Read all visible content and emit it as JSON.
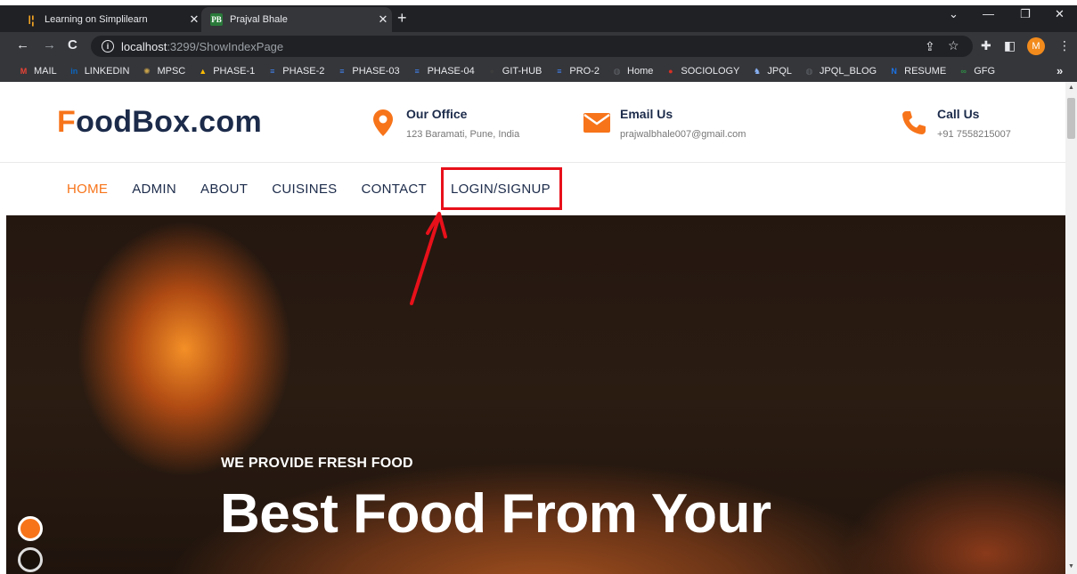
{
  "browser": {
    "tabs": [
      {
        "title": "Learning on Simplilearn",
        "favicon": "simplilearn-icon",
        "active": false
      },
      {
        "title": "Prajval Bhale",
        "favicon": "PB",
        "active": true
      }
    ],
    "url_host": "localhost",
    "url_path": ":3299/ShowIndexPage",
    "profile_initial": "M",
    "bookmarks": [
      {
        "label": "MAIL",
        "icon": "gmail-icon",
        "color": "#ea4335",
        "glyph": "M"
      },
      {
        "label": "LINKEDIN",
        "icon": "linkedin-icon",
        "color": "#0a66c2",
        "glyph": "in"
      },
      {
        "label": "MPSC",
        "icon": "emblem-icon",
        "color": "#c8a24a",
        "glyph": "✺"
      },
      {
        "label": "PHASE-1",
        "icon": "drive-icon",
        "color": "#fbbc04",
        "glyph": "▲"
      },
      {
        "label": "PHASE-2",
        "icon": "docs-icon",
        "color": "#4285f4",
        "glyph": "≡"
      },
      {
        "label": "PHASE-03",
        "icon": "docs-icon",
        "color": "#4285f4",
        "glyph": "≡"
      },
      {
        "label": "PHASE-04",
        "icon": "docs-icon",
        "color": "#4285f4",
        "glyph": "≡"
      },
      {
        "label": "GIT-HUB",
        "icon": "github-icon",
        "color": "#3c3c3c",
        "glyph": "●"
      },
      {
        "label": "PRO-2",
        "icon": "docs-icon",
        "color": "#4285f4",
        "glyph": "≡"
      },
      {
        "label": "Home",
        "icon": "globe-icon",
        "color": "#5f6368",
        "glyph": "◍"
      },
      {
        "label": "SOCIOLOGY",
        "icon": "red-book-icon",
        "color": "#d93025",
        "glyph": "●"
      },
      {
        "label": "JPQL",
        "icon": "jpql-icon",
        "color": "#8ab4f8",
        "glyph": "♞"
      },
      {
        "label": "JPQL_BLOG",
        "icon": "globe-icon",
        "color": "#5f6368",
        "glyph": "◍"
      },
      {
        "label": "RESUME",
        "icon": "resume-icon",
        "color": "#1a73e8",
        "glyph": "N"
      },
      {
        "label": "GFG",
        "icon": "gfg-icon",
        "color": "#2f8d46",
        "glyph": "∞"
      }
    ]
  },
  "site": {
    "logo_first": "F",
    "logo_rest": "oodBox.com",
    "office": {
      "label": "Our Office",
      "value": "123 Baramati, Pune, India"
    },
    "email": {
      "label": "Email Us",
      "value": "prajwalbhale007@gmail.com"
    },
    "call": {
      "label": "Call Us",
      "value": "+91 7558215007"
    },
    "nav": [
      "HOME",
      "ADMIN",
      "ABOUT",
      "CUISINES",
      "CONTACT",
      "LOGIN/SIGNUP"
    ],
    "hero_sub": "WE PROVIDE FRESH FOOD",
    "hero_title": "Best Food From Your"
  },
  "colors": {
    "accent": "#f7741a",
    "navy": "#1c2b4a",
    "annotation": "#e8101a"
  }
}
